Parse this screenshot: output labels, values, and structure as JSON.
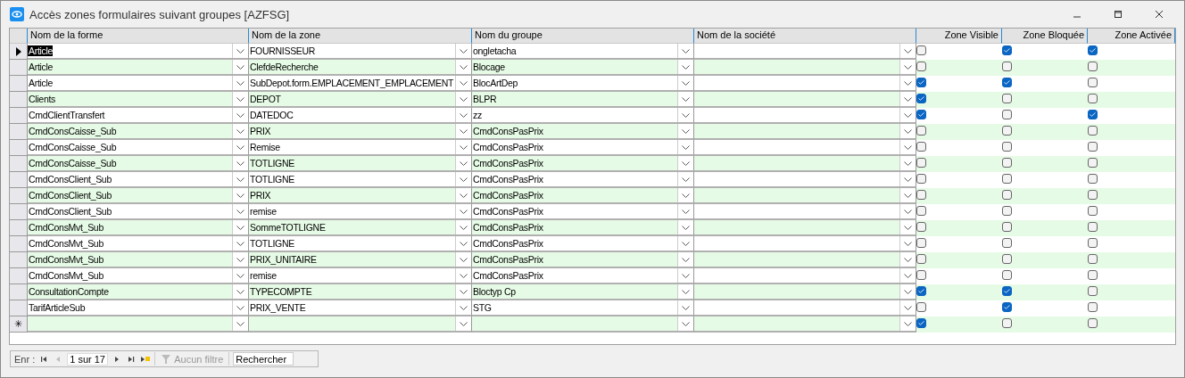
{
  "window": {
    "title": "Accès zones formulaires suivant groupes [AZFSG]"
  },
  "table": {
    "columns": [
      {
        "label": "Nom de la forme",
        "kind": "combo"
      },
      {
        "label": "Nom de la zone",
        "kind": "combo"
      },
      {
        "label": "Nom du groupe",
        "kind": "combo"
      },
      {
        "label": "Nom de la société",
        "kind": "combo"
      },
      {
        "label": "Zone Visible",
        "kind": "check"
      },
      {
        "label": "Zone Bloquée",
        "kind": "check"
      },
      {
        "label": "Zone Activée",
        "kind": "check"
      }
    ],
    "rows": [
      {
        "current": true,
        "forme": "Article",
        "zone": "FOURNISSEUR",
        "groupe": "ongletacha",
        "visible": false,
        "bloquee": true,
        "activee": true
      },
      {
        "current": false,
        "forme": "Article",
        "zone": "ClefdeRecherche",
        "groupe": "Blocage",
        "visible": false,
        "bloquee": false,
        "activee": false
      },
      {
        "current": false,
        "forme": "Article",
        "zone": "SubDepot.form.EMPLACEMENT_EMPLACEMENT",
        "groupe": "BlocArtDep",
        "visible": true,
        "bloquee": true,
        "activee": false
      },
      {
        "current": false,
        "forme": "Clients",
        "zone": "DEPOT",
        "groupe": "BLPR",
        "visible": true,
        "bloquee": false,
        "activee": false
      },
      {
        "current": false,
        "forme": "CmdClientTransfert",
        "zone": "DATEDOC",
        "groupe": "zz",
        "visible": true,
        "bloquee": false,
        "activee": true
      },
      {
        "current": false,
        "forme": "CmdConsCaisse_Sub",
        "zone": "PRIX",
        "groupe": "CmdConsPasPrix",
        "visible": false,
        "bloquee": false,
        "activee": false
      },
      {
        "current": false,
        "forme": "CmdConsCaisse_Sub",
        "zone": "Remise",
        "groupe": "CmdConsPasPrix",
        "visible": false,
        "bloquee": false,
        "activee": false
      },
      {
        "current": false,
        "forme": "CmdConsCaisse_Sub",
        "zone": "TOTLIGNE",
        "groupe": "CmdConsPasPrix",
        "visible": false,
        "bloquee": false,
        "activee": false
      },
      {
        "current": false,
        "forme": "CmdConsClient_Sub",
        "zone": "TOTLIGNE",
        "groupe": "CmdConsPasPrix",
        "visible": false,
        "bloquee": false,
        "activee": false
      },
      {
        "current": false,
        "forme": "CmdConsClient_Sub",
        "zone": "PRIX",
        "groupe": "CmdConsPasPrix",
        "visible": false,
        "bloquee": false,
        "activee": false
      },
      {
        "current": false,
        "forme": "CmdConsClient_Sub",
        "zone": "remise",
        "groupe": "CmdConsPasPrix",
        "visible": false,
        "bloquee": false,
        "activee": false
      },
      {
        "current": false,
        "forme": "CmdConsMvt_Sub",
        "zone": "SommeTOTLIGNE",
        "groupe": "CmdConsPasPrix",
        "visible": false,
        "bloquee": false,
        "activee": false
      },
      {
        "current": false,
        "forme": "CmdConsMvt_Sub",
        "zone": "TOTLIGNE",
        "groupe": "CmdConsPasPrix",
        "visible": false,
        "bloquee": false,
        "activee": false
      },
      {
        "current": false,
        "forme": "CmdConsMvt_Sub",
        "zone": "PRIX_UNITAIRE",
        "groupe": "CmdConsPasPrix",
        "visible": false,
        "bloquee": false,
        "activee": false
      },
      {
        "current": false,
        "forme": "CmdConsMvt_Sub",
        "zone": "remise",
        "groupe": "CmdConsPasPrix",
        "visible": false,
        "bloquee": false,
        "activee": false
      },
      {
        "current": false,
        "forme": "ConsultationCompte",
        "zone": "TYPECOMPTE",
        "groupe": "Bloctyp Cp",
        "visible": true,
        "bloquee": true,
        "activee": false
      },
      {
        "current": false,
        "forme": "TarifArticleSub",
        "zone": "PRIX_VENTE",
        "groupe": "STG",
        "visible": false,
        "bloquee": true,
        "activee": false
      }
    ],
    "new_row": {
      "marker": "✳",
      "visible": true,
      "bloquee": false,
      "activee": false
    }
  },
  "navigation": {
    "label": "Enr :",
    "position": "1 sur 17",
    "filter": "Aucun filtre",
    "filter_disabled": true,
    "search_placeholder": "Rechercher"
  }
}
